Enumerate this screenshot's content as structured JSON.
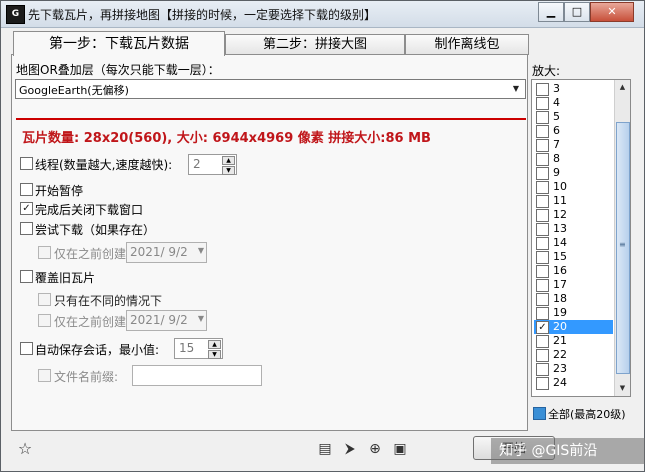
{
  "window": {
    "title": "先下载瓦片，再拼接地图【拼接的时候，一定要选择下载的级别】",
    "icon_text": "G"
  },
  "tabs": [
    {
      "label": "第一步：下载瓦片数据"
    },
    {
      "label": "第二步：拼接大图"
    },
    {
      "label": "制作离线包"
    }
  ],
  "layer": {
    "label": "地图OR叠加层（每次只能下载一层）：",
    "selected": "GoogleEarth(无偏移)"
  },
  "summary": "瓦片数量: 28x20(560), 大小: 6944x4969 像素 拼接大小:86 MB",
  "options": {
    "threads_label": "线程(数量越大,速度越快):",
    "threads_value": "2",
    "pause_label": "开始暂停",
    "close_after_label": "完成后关闭下载窗口",
    "try_download_label": "尝试下载（如果存在）",
    "only_before_label": "仅在之前创建",
    "date1": "2021/  9/2",
    "overwrite_label": "覆盖旧瓦片",
    "only_diff_label": "只有在不同的情况下",
    "only_before2_label": "仅在之前创建",
    "date2": "2021/  9/2",
    "autosave_label": "自动保存会话，最小值:",
    "autosave_value": "15",
    "prefix_label": "文件名前缀:",
    "prefix_value": ""
  },
  "zoom": {
    "label": "放大:",
    "levels": [
      "3",
      "4",
      "5",
      "6",
      "7",
      "8",
      "9",
      "10",
      "11",
      "12",
      "13",
      "14",
      "15",
      "16",
      "17",
      "18",
      "19",
      "20",
      "21",
      "22",
      "23",
      "24"
    ],
    "selected_level": "20",
    "all_label": "全部(最高20级)"
  },
  "bottom": {
    "start_label": "开始"
  },
  "watermark": "知乎 @GIS前沿"
}
